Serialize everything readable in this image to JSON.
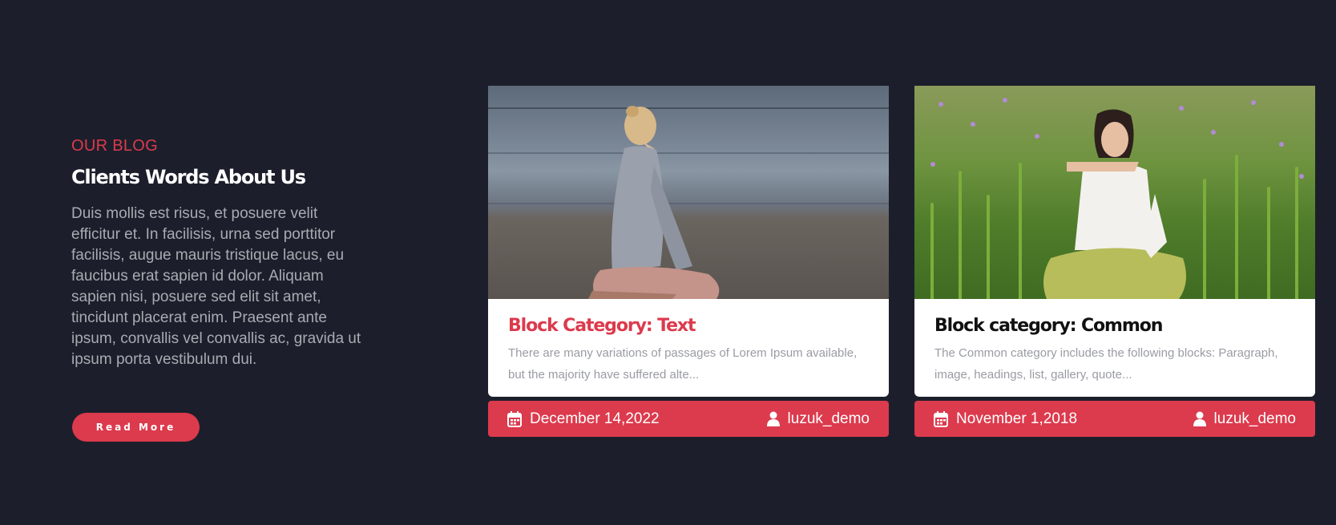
{
  "intro": {
    "eyebrow": "OUR BLOG",
    "heading": "Clients Words About Us",
    "body": "Duis mollis est risus, et posuere velit efficitur et. In facilisis, urna sed porttitor facilisis, augue mauris tristique lacus, eu faucibus erat sapien id dolor. Aliquam sapien nisi, posuere sed elit sit amet, tincidunt placerat enim. Praesent ante ipsum, convallis vel convallis ac, gravida ut ipsum porta vestibulum dui.",
    "button_label": "Read More"
  },
  "cards": [
    {
      "title": "Block Category: Text",
      "excerpt": "There are many variations of passages of Lorem Ipsum available, but the majority have suffered alte...",
      "date": "December 14,2022",
      "author": "luzuk_demo",
      "date_icon": "calendar-icon",
      "author_icon": "user-icon"
    },
    {
      "title": "Block category: Common",
      "excerpt": "The Common category includes the following blocks: Paragraph, image, headings, list, gallery, quote...",
      "date": "November 1,2018",
      "author": "luzuk_demo",
      "date_icon": "calendar-icon",
      "author_icon": "user-icon"
    }
  ],
  "colors": {
    "background": "#1c1f2b",
    "accent": "#dc3a4d",
    "card": "#ffffff",
    "muted_text": "#a9abb2"
  }
}
